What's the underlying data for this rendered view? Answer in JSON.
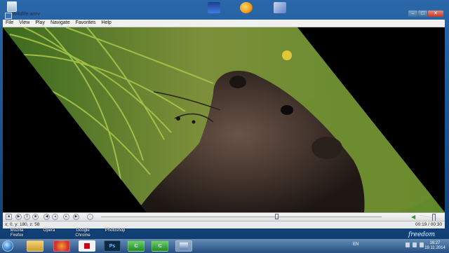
{
  "desktop": {
    "labels": [
      "Mozilla Firefox",
      "Opera",
      "Google Chrome",
      "Photoshop"
    ],
    "watermark": "freedom"
  },
  "window": {
    "title": "Wildlife.wmv",
    "menu": [
      "File",
      "View",
      "Play",
      "Navigate",
      "Favorites",
      "Help"
    ],
    "window_buttons": {
      "min": "–",
      "max": "□",
      "close": "✕"
    }
  },
  "player": {
    "status_left": "x: 0, y: 180, z: 58",
    "status_right": "00:19 / 00:30",
    "seek_position_percent": 63,
    "volume_level_percent": 60,
    "buttons": [
      "stop",
      "play",
      "pause",
      "prev",
      "rew",
      "fwd",
      "next",
      "frame"
    ]
  },
  "taskbar": {
    "apps": [
      "folder",
      "firefox",
      "pdf",
      "photoshop",
      "camtasia-green",
      "camtasia",
      "media-player"
    ],
    "photoshop_label": "Ps",
    "language": "EN",
    "clock_time": "16:27",
    "clock_date": "19.11.2014"
  }
}
